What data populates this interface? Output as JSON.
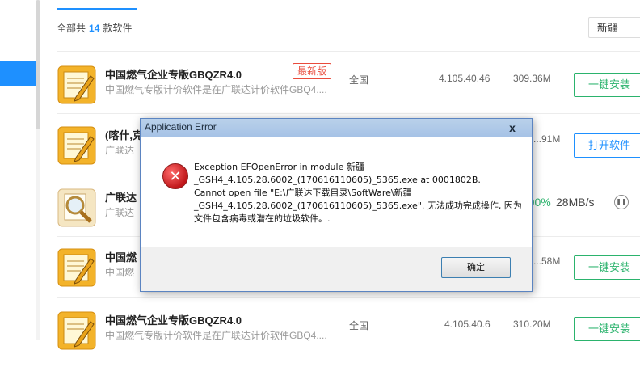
{
  "toolbar": {
    "prefix": "全部共",
    "count": "14",
    "suffix": "款软件",
    "region_select": "新疆"
  },
  "rows": [
    {
      "name": "中国燃气企业专版GBQZR4.0",
      "desc": "中国燃气专版计价软件是在广联达计价软件GBQ4....",
      "badge": "最新版",
      "region": "全国",
      "version": "4.105.40.46",
      "size": "309.36M",
      "action": "一键安装"
    },
    {
      "name": "(喀什,克",
      "desc": "广联达",
      "size": "...91M",
      "action": "打开软件"
    },
    {
      "name": "广联达",
      "desc": "广联达",
      "progress": "...00%",
      "speed": "28MB/s"
    },
    {
      "name": "中国燃",
      "desc": "中国燃",
      "size": "...58M",
      "action": "一键安装"
    },
    {
      "name": "中国燃气企业专版GBQZR4.0",
      "desc": "中国燃气专版计价软件是在广联达计价软件GBQ4....",
      "region": "全国",
      "version": "4.105.40.6",
      "size": "310.20M",
      "action": "一键安装"
    }
  ],
  "dialog": {
    "title": "Application Error",
    "close": "x",
    "lines": [
      "Exception EFOpenError in module 新疆",
      "_GSH4_4.105.28.6002_(170616110605)_5365.exe at 0001802B.",
      "Cannot open file \"E:\\广联达下载目录\\SoftWare\\新疆",
      "_GSH4_4.105.28.6002_(170616110605)_5365.exe\". 无法成功完成操作, 因为",
      "文件包含病毒或潜在的垃圾软件。."
    ],
    "ok": "确定"
  },
  "colors": {
    "accent": "#1e90ff",
    "install_green": "#2bb36d",
    "badge_red": "#e94b3c"
  }
}
